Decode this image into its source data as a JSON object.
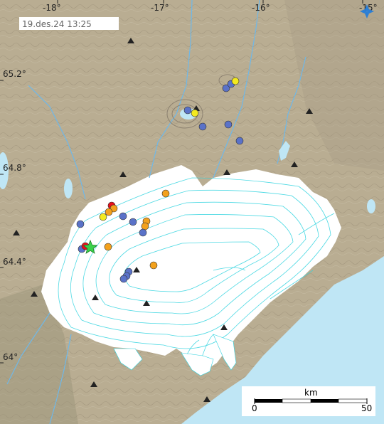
{
  "timestamp": "19.des.24 13:25",
  "longitude_ticks": [
    {
      "label": "-18°"
    },
    {
      "label": "-17°"
    },
    {
      "label": "-16°"
    },
    {
      "label": "-15°"
    }
  ],
  "latitude_ticks": [
    {
      "label": "65.2°"
    },
    {
      "label": "64.8°"
    },
    {
      "label": "64.4°"
    },
    {
      "label": "64°"
    }
  ],
  "scale_bar": {
    "unit": "km",
    "min_label": "0",
    "max_label": "50"
  },
  "colors": {
    "land": "#b9ad92",
    "glacier": "#ffffff",
    "glacier_contours": "#2fd3df",
    "sea": "#bfe6f5",
    "rivers": "#6fb8e8",
    "quake_old": "#5a72c8",
    "quake_mid": "#f3a11c",
    "quake_recent": "#f3ea1e",
    "quake_latest": "#e8101a",
    "star": "#39d24a",
    "volcano": "#222222"
  }
}
